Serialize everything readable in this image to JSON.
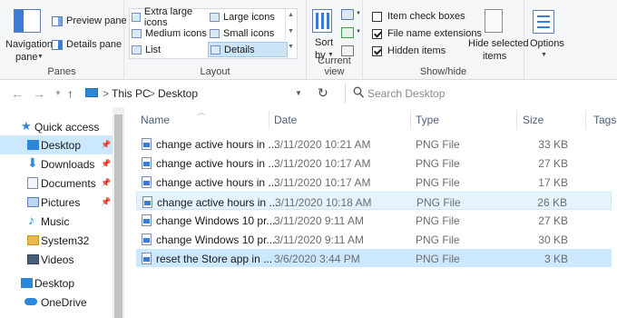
{
  "ribbon": {
    "panes": {
      "navigation_pane_label": "Navigation pane",
      "navigation_pane_line1": "Navigation",
      "navigation_pane_line2": "pane",
      "preview_pane": "Preview pane",
      "details_pane": "Details pane",
      "group_label": "Panes"
    },
    "layout": {
      "options": [
        "Extra large icons",
        "Large icons",
        "Medium icons",
        "Small icons",
        "List",
        "Details"
      ],
      "selected": "Details",
      "group_label": "Layout"
    },
    "current_view": {
      "sort_line1": "Sort",
      "sort_line2": "by",
      "group_label": "Current view"
    },
    "show_hide": {
      "item_check_boxes": "Item check boxes",
      "item_check_boxes_checked": false,
      "file_name_extensions": "File name extensions",
      "file_name_extensions_checked": true,
      "hidden_items": "Hidden items",
      "hidden_items_checked": true,
      "hide_selected_line1": "Hide selected",
      "hide_selected_line2": "items",
      "group_label": "Show/hide"
    },
    "options_label": "Options"
  },
  "address": {
    "path": [
      "This PC",
      "Desktop"
    ],
    "separator": ">",
    "search_placeholder": "Search Desktop"
  },
  "navigation": {
    "items": [
      {
        "label": "Quick access",
        "icon": "star-icon",
        "pinned": false,
        "selected": false
      },
      {
        "label": "Desktop",
        "icon": "desktop-folder-icon",
        "pinned": true,
        "selected": true
      },
      {
        "label": "Downloads",
        "icon": "download-folder-icon",
        "pinned": true,
        "selected": false
      },
      {
        "label": "Documents",
        "icon": "documents-folder-icon",
        "pinned": true,
        "selected": false
      },
      {
        "label": "Pictures",
        "icon": "pictures-folder-icon",
        "pinned": true,
        "selected": false
      },
      {
        "label": "Music",
        "icon": "music-icon",
        "pinned": false,
        "selected": false
      },
      {
        "label": "System32",
        "icon": "folder-icon",
        "pinned": false,
        "selected": false
      },
      {
        "label": "Videos",
        "icon": "videos-folder-icon",
        "pinned": false,
        "selected": false
      },
      {
        "label": "Desktop",
        "icon": "desktop-folder-icon",
        "pinned": false,
        "selected": false
      },
      {
        "label": "OneDrive",
        "icon": "cloud-icon",
        "pinned": false,
        "selected": false
      }
    ]
  },
  "files": {
    "columns": [
      "Name",
      "Date",
      "Type",
      "Size",
      "Tags"
    ],
    "rows": [
      {
        "name": "change active hours in ...",
        "date": "3/11/2020 10:21 AM",
        "type": "PNG File",
        "size": "33 KB",
        "state": "normal"
      },
      {
        "name": "change active hours in ...",
        "date": "3/11/2020 10:17 AM",
        "type": "PNG File",
        "size": "27 KB",
        "state": "normal"
      },
      {
        "name": "change active hours in ...",
        "date": "3/11/2020 10:17 AM",
        "type": "PNG File",
        "size": "17 KB",
        "state": "normal"
      },
      {
        "name": "change active hours in ...",
        "date": "3/11/2020 10:18 AM",
        "type": "PNG File",
        "size": "26 KB",
        "state": "hover"
      },
      {
        "name": "change Windows 10 pr...",
        "date": "3/11/2020 9:11 AM",
        "type": "PNG File",
        "size": "27 KB",
        "state": "normal"
      },
      {
        "name": "change Windows 10 pr...",
        "date": "3/11/2020 9:11 AM",
        "type": "PNG File",
        "size": "30 KB",
        "state": "normal"
      },
      {
        "name": "reset the Store app in ...",
        "date": "3/6/2020 3:44 PM",
        "type": "PNG File",
        "size": "3 KB",
        "state": "selected"
      }
    ]
  },
  "colors": {
    "ribbon_bg": "#f5f6f7",
    "selected_bg": "#cce8ff",
    "hover_bg": "#e5f3ff",
    "accent": "#0078d7",
    "header_text": "#4c607a"
  }
}
